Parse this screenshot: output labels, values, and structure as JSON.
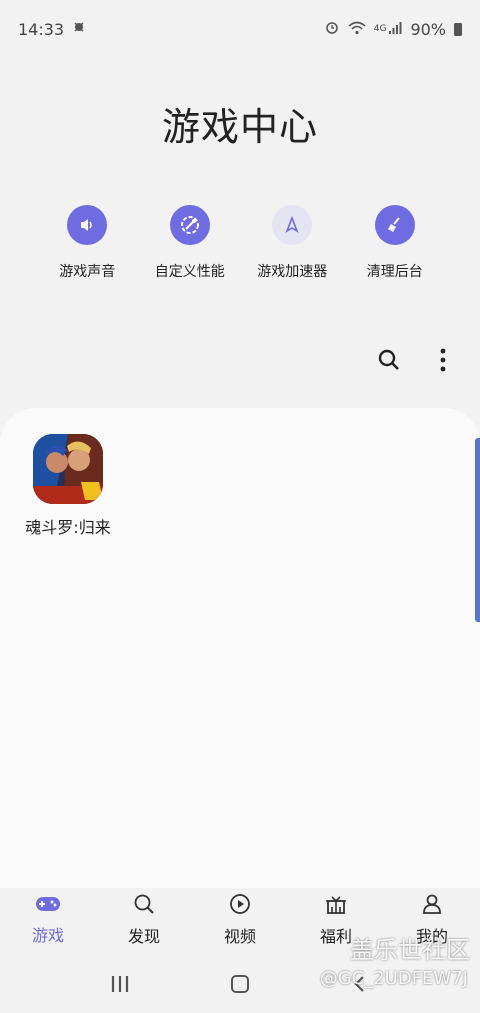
{
  "status_bar": {
    "time": "14:33",
    "network": "4G",
    "battery": "90%"
  },
  "page": {
    "title": "游戏中心"
  },
  "quick_actions": [
    {
      "label": "游戏声音",
      "icon": "speaker-icon"
    },
    {
      "label": "自定义性能",
      "icon": "performance-icon"
    },
    {
      "label": "游戏加速器",
      "icon": "booster-icon"
    },
    {
      "label": "清理后台",
      "icon": "broom-icon"
    }
  ],
  "toolbar": {
    "search_icon": "search-icon",
    "more_icon": "more-vertical-icon"
  },
  "games": [
    {
      "name": "魂斗罗:归来"
    }
  ],
  "bottom_nav": [
    {
      "label": "游戏",
      "icon": "gamepad-icon",
      "active": true
    },
    {
      "label": "发现",
      "icon": "search-icon",
      "active": false
    },
    {
      "label": "视频",
      "icon": "play-icon",
      "active": false
    },
    {
      "label": "福利",
      "icon": "gift-icon",
      "active": false
    },
    {
      "label": "我的",
      "icon": "person-icon",
      "active": false
    }
  ],
  "watermark": {
    "title": "盖乐世社区",
    "user": "@GC_2UDFEW7J"
  },
  "colors": {
    "accent": "#6e6ce0",
    "background": "#f2f2f2",
    "panel": "#fafafa",
    "scroll": "#5a74c8"
  }
}
